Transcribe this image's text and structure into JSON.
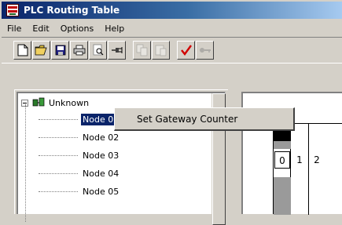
{
  "window": {
    "title": "PLC Routing Table"
  },
  "menu": {
    "items": [
      "File",
      "Edit",
      "Options",
      "Help"
    ]
  },
  "toolbar": {
    "buttons": [
      {
        "icon": "new-file-icon",
        "enabled": true
      },
      {
        "icon": "open-folder-icon",
        "enabled": true
      },
      {
        "icon": "save-disk-icon",
        "enabled": true
      },
      {
        "icon": "print-icon",
        "enabled": true
      },
      {
        "icon": "print-preview-icon",
        "enabled": true
      },
      {
        "icon": "connect-plug-icon",
        "enabled": true
      },
      {
        "icon": "copy-table-icon",
        "enabled": false
      },
      {
        "icon": "paste-table-icon",
        "enabled": false
      },
      {
        "icon": "check-mark-icon",
        "enabled": true
      },
      {
        "icon": "key-icon",
        "enabled": false
      }
    ]
  },
  "tree": {
    "root_label": "Unknown",
    "nodes": [
      {
        "label": "Node 01",
        "selected": true
      },
      {
        "label": "Node 02",
        "selected": false
      },
      {
        "label": "Node 03",
        "selected": false
      },
      {
        "label": "Node 04",
        "selected": false
      },
      {
        "label": "Node 05",
        "selected": false
      }
    ]
  },
  "context_menu": {
    "items": [
      "Set Gateway Counter"
    ]
  },
  "slots": {
    "numbers": [
      "0",
      "1",
      "2"
    ]
  },
  "colors": {
    "title_start": "#0a246a",
    "title_end": "#a6caf0",
    "selection": "#0a246a",
    "face": "#d4d0c8"
  }
}
